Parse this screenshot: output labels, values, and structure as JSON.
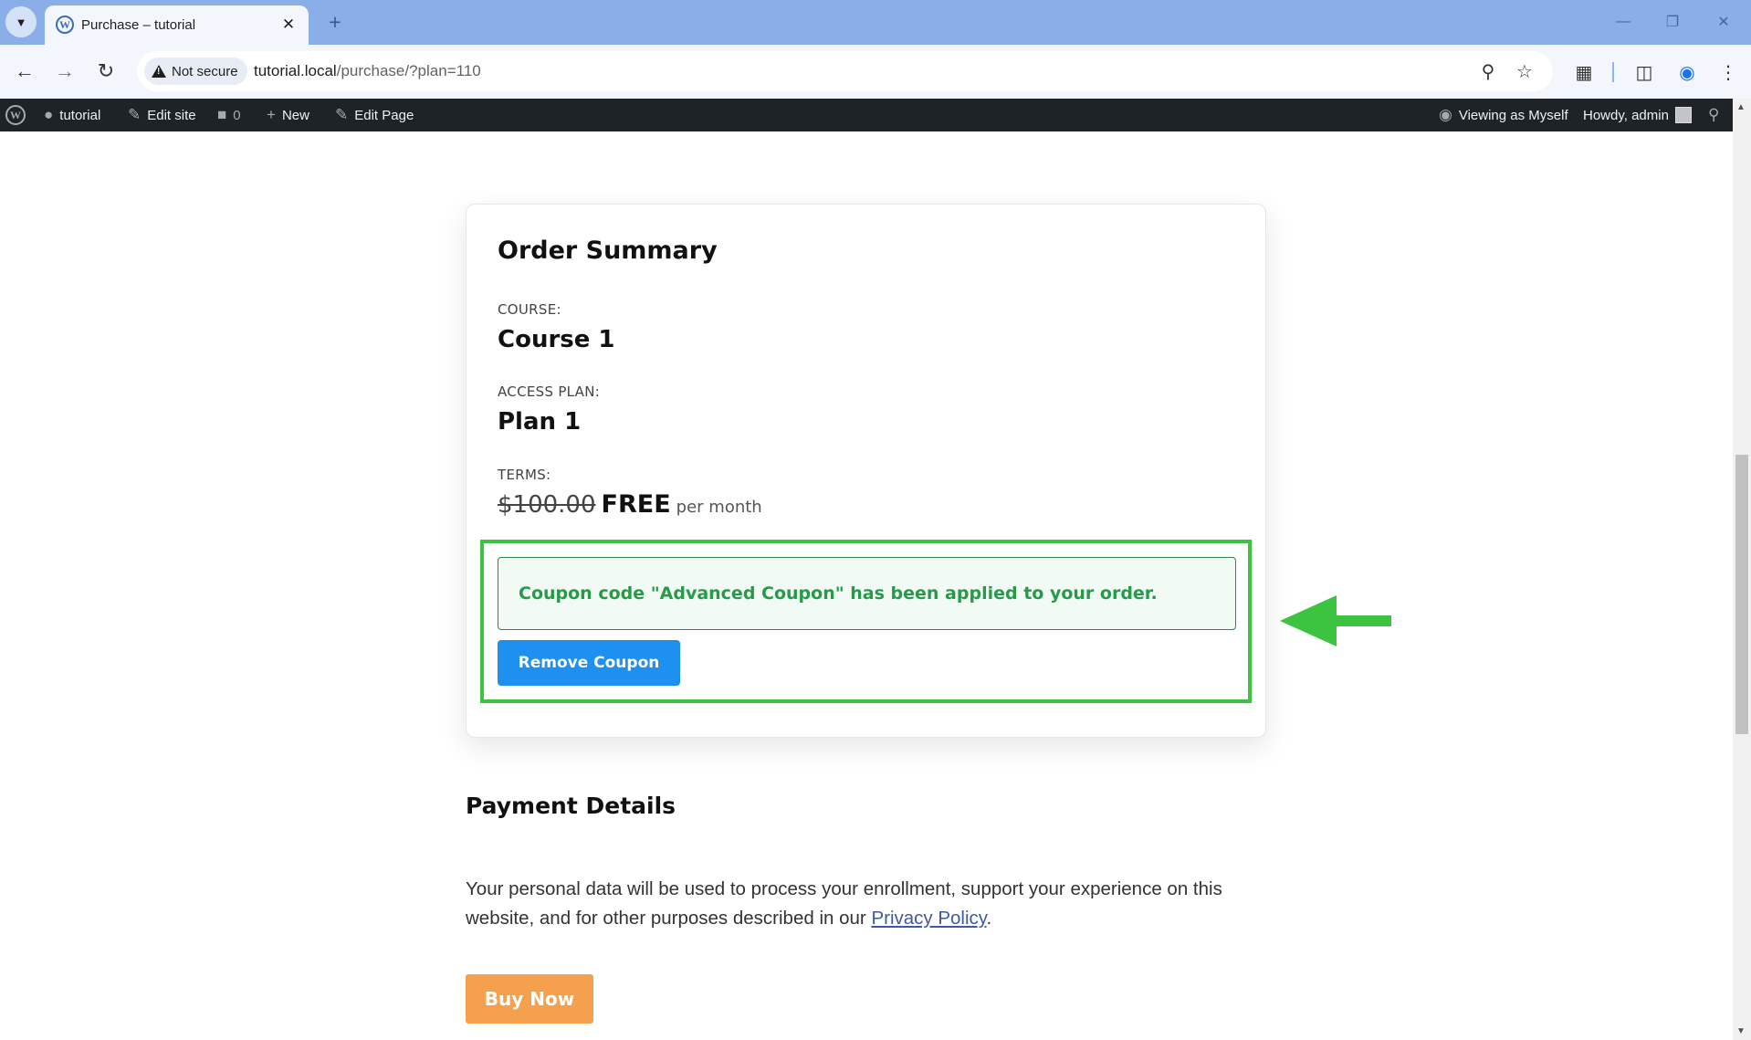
{
  "browser": {
    "tab_title": "Purchase – tutorial",
    "security_label": "Not secure",
    "url_host": "tutorial.local",
    "url_path": "/purchase/?plan=110"
  },
  "admin_bar": {
    "site_name": "tutorial",
    "edit_site": "Edit site",
    "comments_count": "0",
    "new_label": "New",
    "edit_page": "Edit Page",
    "viewing_as": "Viewing as Myself",
    "howdy": "Howdy, admin"
  },
  "order_summary": {
    "title": "Order Summary",
    "course_label": "COURSE:",
    "course_value": "Course 1",
    "plan_label": "ACCESS PLAN:",
    "plan_value": "Plan 1",
    "terms_label": "TERMS:",
    "old_price": "$100.00",
    "new_price": "FREE",
    "period": "per month",
    "coupon_message": "Coupon code \"Advanced Coupon\" has been applied to your order.",
    "remove_coupon_label": "Remove Coupon"
  },
  "payment": {
    "title": "Payment Details",
    "privacy_text": "Your personal data will be used to process your enrollment, support your experience on this website, and for other purposes described in our",
    "privacy_link": "Privacy Policy",
    "privacy_end": ".",
    "buy_now_label": "Buy Now"
  },
  "colors": {
    "highlight": "#3cc441",
    "coupon_text": "#279a4a",
    "remove_button": "#1e90f0",
    "buy_button": "#f5a04d",
    "admin_bar": "#1d2327"
  }
}
